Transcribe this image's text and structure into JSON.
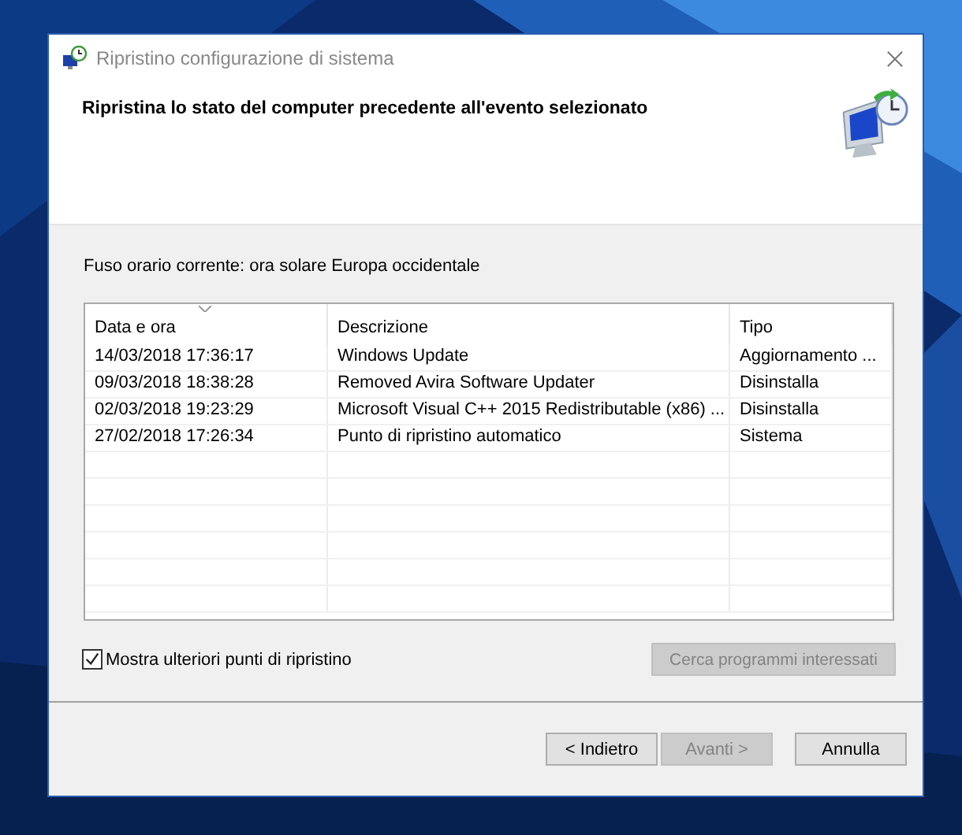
{
  "window": {
    "title": "Ripristino configurazione di sistema"
  },
  "heading": "Ripristina lo stato del computer precedente all'evento selezionato",
  "timezone_label": "Fuso orario corrente: ora solare Europa occidentale",
  "table": {
    "columns": [
      {
        "label": "Data e ora",
        "sorted": true
      },
      {
        "label": "Descrizione",
        "sorted": false
      },
      {
        "label": "Tipo",
        "sorted": false
      }
    ],
    "rows": [
      {
        "cells": [
          "14/03/2018 17:36:17",
          "Windows Update",
          "Aggiornamento ..."
        ],
        "selected": false
      },
      {
        "cells": [
          "09/03/2018 18:38:28",
          "Removed Avira Software Updater",
          "Disinstalla"
        ],
        "selected": false
      },
      {
        "cells": [
          "02/03/2018 19:23:29",
          "Microsoft Visual C++ 2015 Redistributable (x86) ...",
          "Disinstalla"
        ],
        "selected": false
      },
      {
        "cells": [
          "27/02/2018 17:26:34",
          "Punto di ripristino automatico",
          "Sistema"
        ],
        "selected": false
      }
    ]
  },
  "show_more": {
    "label": "Mostra ulteriori punti di ripristino",
    "checked": true
  },
  "scan_button": {
    "label": "Cerca programmi interessati",
    "disabled": true
  },
  "buttons": [
    {
      "label": "< Indietro",
      "disabled": false
    },
    {
      "label": "Avanti >",
      "disabled": true
    },
    {
      "label": "Annulla",
      "disabled": false
    }
  ]
}
